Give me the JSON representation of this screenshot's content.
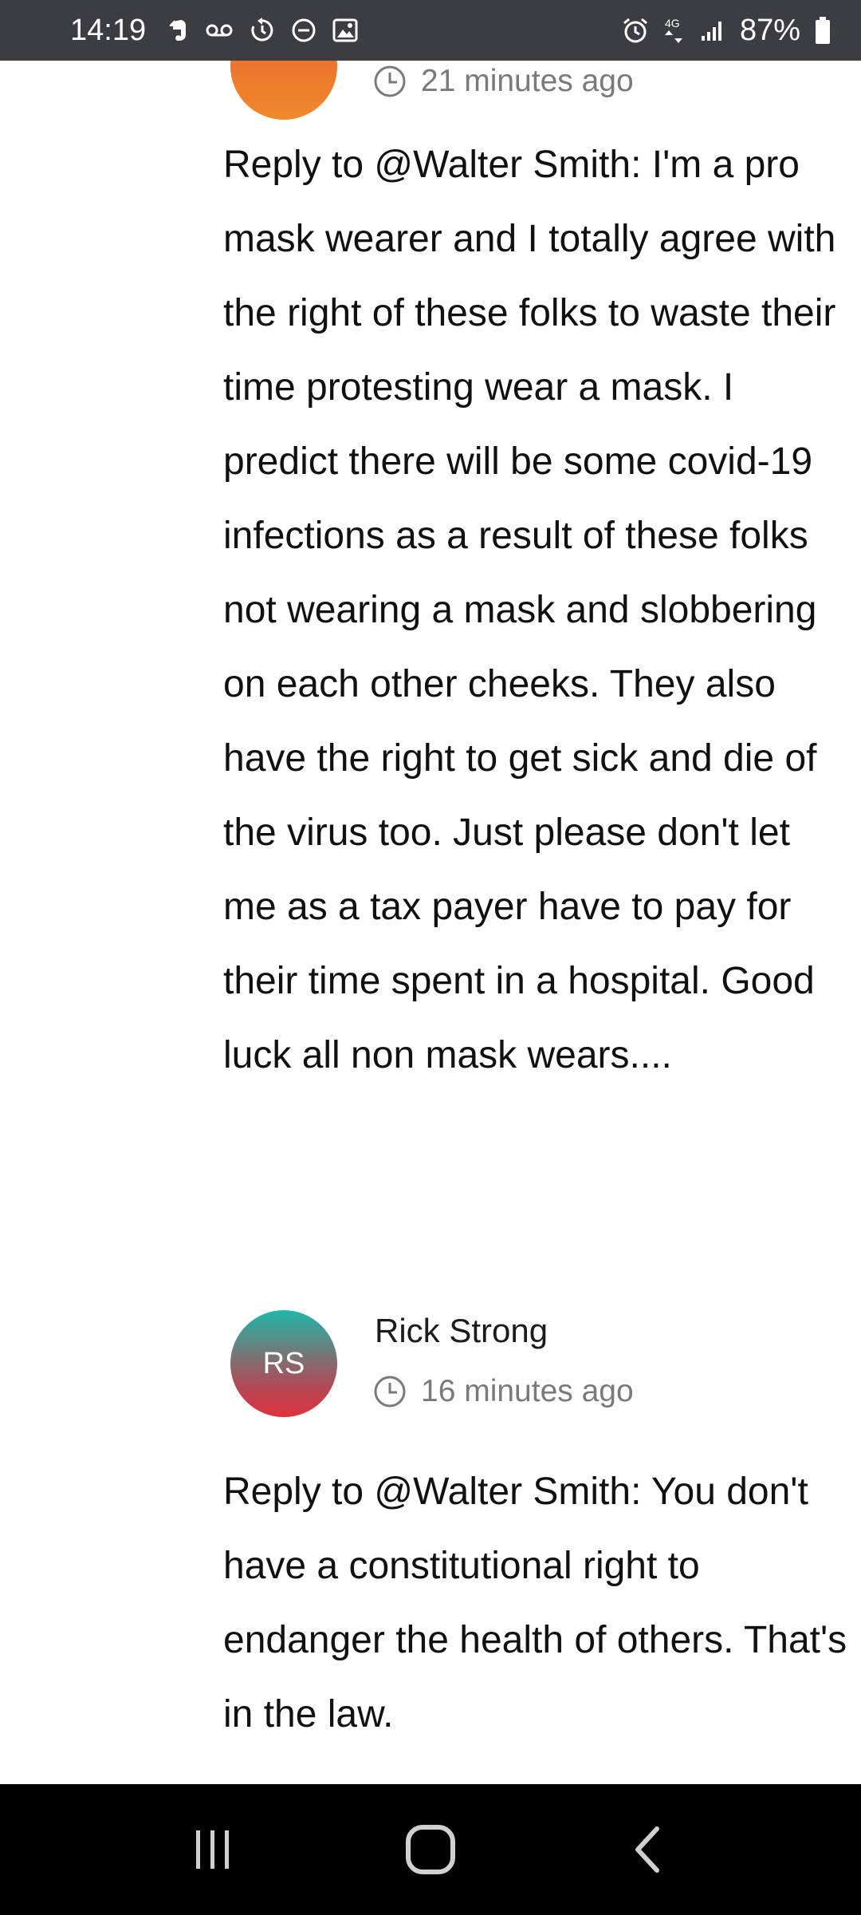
{
  "status_bar": {
    "time": "14:19",
    "battery_percent": "87%",
    "network_label": "4G",
    "left_icons": [
      "evernote-icon",
      "voicemail-icon",
      "sync-icon",
      "do-not-disturb-icon",
      "image-icon"
    ],
    "right_icons": [
      "alarm-icon",
      "4g-data-icon",
      "signal-icon",
      "battery-icon"
    ]
  },
  "comments": [
    {
      "avatar_initials": "",
      "author": "",
      "time_ago": "21 minutes ago",
      "body": "Reply to @Walter Smith: I'm a pro mask wearer and I totally agree with the right of these folks to waste their time protesting wear a mask. I predict there will be some covid-19 infections as a result of these folks not wearing a mask and slobbering on each other cheeks. They also have the right to get sick and die of the virus too. Just please don't let me as a tax payer have to pay for their time spent in a hospital. Good luck all non mask wears...."
    },
    {
      "avatar_initials": "RS",
      "author": "Rick Strong",
      "time_ago": "16 minutes ago",
      "body": "Reply to @Walter Smith: You don't have a constitutional right to endanger the health of others. That's in the law."
    }
  ],
  "nav_bar": {
    "buttons": [
      "recent-apps-icon",
      "home-icon",
      "back-icon"
    ]
  },
  "colors": {
    "status_bar_bg": "#3b3d42",
    "avatar_orange": "#ee7a2d",
    "avatar_teal": "#1fb7a8",
    "avatar_red": "#e0323e",
    "meta_text": "#7a7a7a"
  }
}
